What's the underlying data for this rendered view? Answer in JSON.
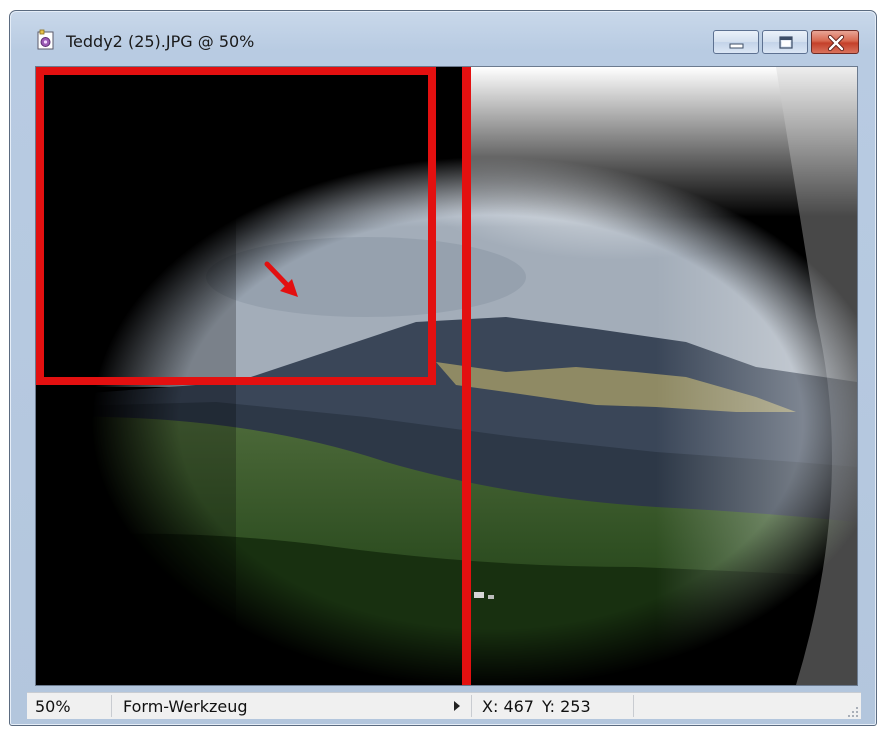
{
  "window": {
    "title": "Teddy2 (25).JPG @ 50%",
    "icon": "paintshop-image-icon",
    "buttons": {
      "minimize": "minimize-icon",
      "maximize": "maximize-icon",
      "close": "close-icon"
    }
  },
  "statusbar": {
    "zoom": "50%",
    "tool": "Form-Werkzeug",
    "x": "X: 467",
    "y": "Y: 253"
  },
  "colors": {
    "highlight_red": "#e31010",
    "close_button": "#c9452f",
    "frame": "#b8cbe2"
  }
}
